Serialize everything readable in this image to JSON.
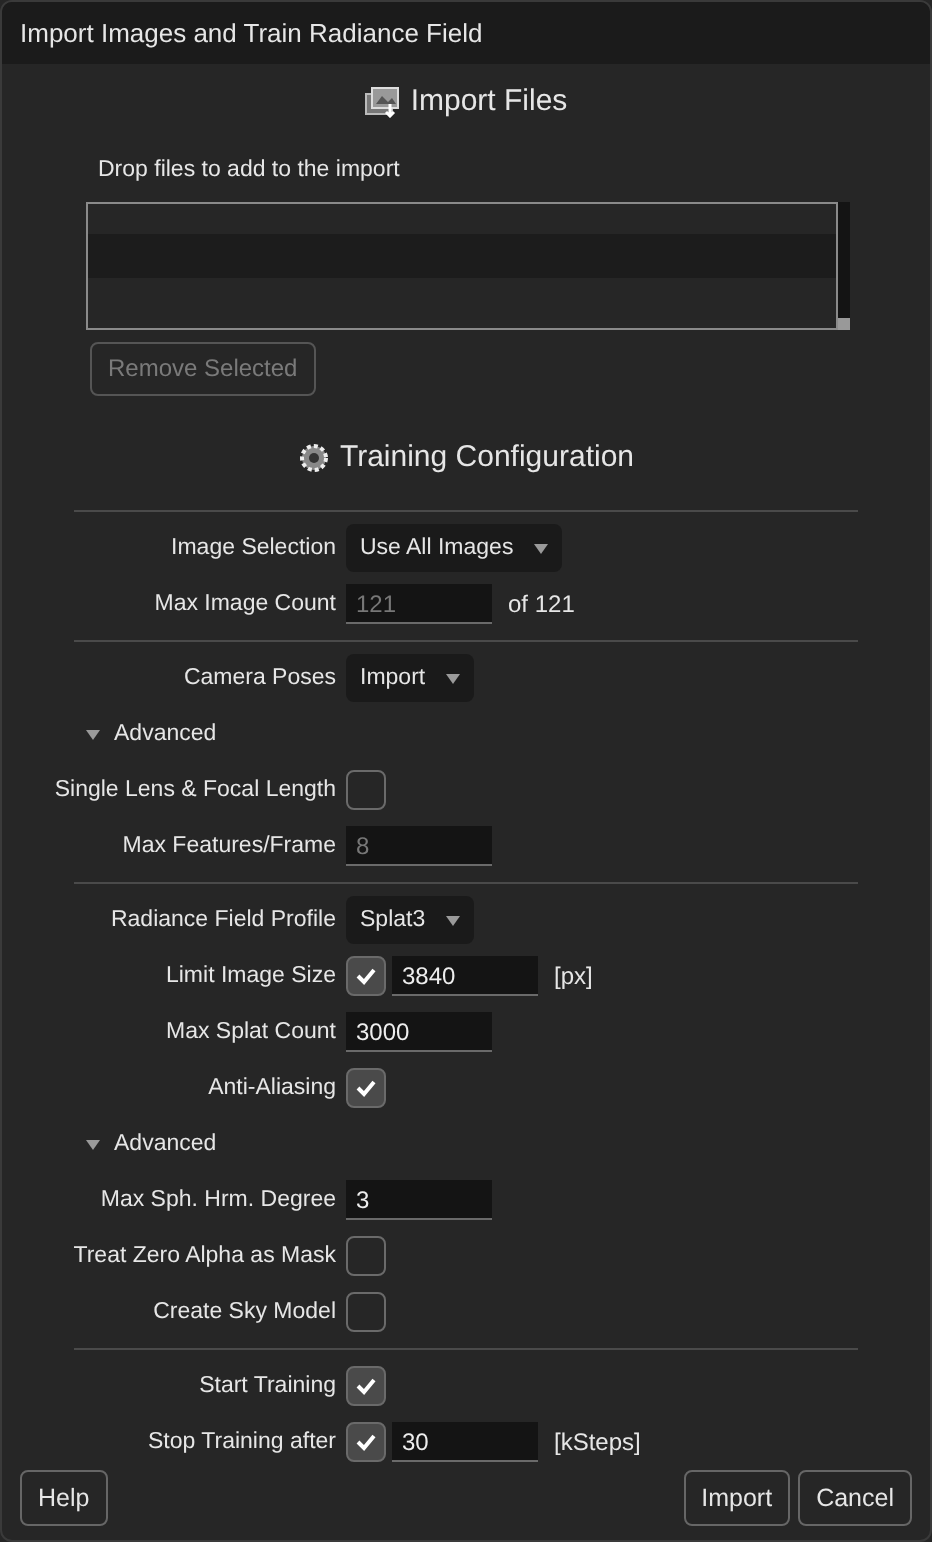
{
  "window": {
    "title": "Import Images and Train Radiance Field"
  },
  "import_files": {
    "heading": "Import Files",
    "hint": "Drop files to add to the import",
    "remove_button": {
      "label": "Remove Selected",
      "disabled": true
    }
  },
  "training": {
    "heading": "Training Configuration",
    "rows": [
      {
        "kind": "divider"
      },
      {
        "kind": "dropdown",
        "label": "Image Selection",
        "value": "Use All Images"
      },
      {
        "kind": "number",
        "label": "Max Image Count",
        "value": "121",
        "disabled": true,
        "suffix": "of 121"
      },
      {
        "kind": "divider"
      },
      {
        "kind": "dropdown",
        "label": "Camera Poses",
        "value": "Import"
      },
      {
        "kind": "section",
        "label": "Advanced",
        "expanded": true
      },
      {
        "kind": "checkbox",
        "label": "Single Lens & Focal Length",
        "checked": false
      },
      {
        "kind": "number",
        "label": "Max Features/Frame",
        "value": "8",
        "disabled": true
      },
      {
        "kind": "divider"
      },
      {
        "kind": "dropdown",
        "label": "Radiance Field Profile",
        "value": "Splat3"
      },
      {
        "kind": "number",
        "label": "Limit Image Size",
        "value": "3840",
        "disabled": false,
        "checked": true,
        "suffix": "[px]"
      },
      {
        "kind": "number",
        "label": "Max Splat Count",
        "value": "3000",
        "disabled": false
      },
      {
        "kind": "checkbox",
        "label": "Anti-Aliasing",
        "checked": true
      },
      {
        "kind": "section",
        "label": "Advanced",
        "expanded": true
      },
      {
        "kind": "number",
        "label": "Max Sph. Hrm. Degree",
        "value": "3",
        "disabled": false
      },
      {
        "kind": "checkbox",
        "label": "Treat Zero Alpha as Mask",
        "checked": false
      },
      {
        "kind": "checkbox",
        "label": "Create Sky Model",
        "checked": false
      },
      {
        "kind": "divider"
      },
      {
        "kind": "checkbox",
        "label": "Start Training",
        "checked": true
      },
      {
        "kind": "number",
        "label": "Stop Training after",
        "value": "30",
        "disabled": false,
        "checked": true,
        "suffix": "[kSteps]"
      }
    ]
  },
  "buttons": {
    "left": [
      {
        "label": "Help"
      }
    ],
    "right": [
      {
        "label": "Import"
      },
      {
        "label": "Cancel"
      }
    ]
  }
}
